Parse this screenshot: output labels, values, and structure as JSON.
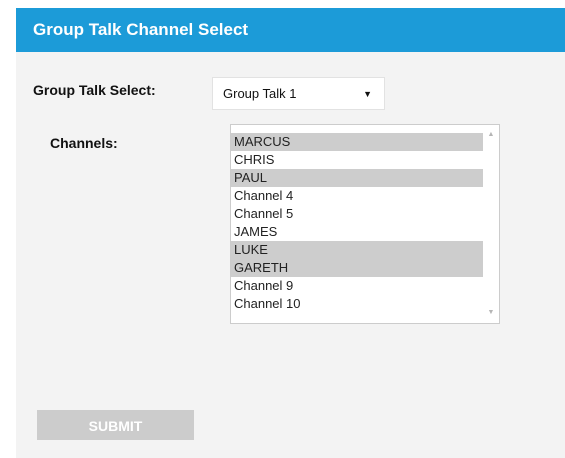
{
  "window": {
    "title": "Group Talk Channel Select"
  },
  "group_talk": {
    "label": "Group Talk Select:",
    "selected": "Group Talk 1",
    "arrow": "▼"
  },
  "channels": {
    "label": "Channels:",
    "items": [
      {
        "label": "MARCUS",
        "selected": true
      },
      {
        "label": "CHRIS",
        "selected": false
      },
      {
        "label": "PAUL",
        "selected": true
      },
      {
        "label": "Channel 4",
        "selected": false
      },
      {
        "label": "Channel 5",
        "selected": false
      },
      {
        "label": "JAMES",
        "selected": false
      },
      {
        "label": "LUKE",
        "selected": true
      },
      {
        "label": "GARETH",
        "selected": true
      },
      {
        "label": "Channel 9",
        "selected": false
      },
      {
        "label": "Channel 10",
        "selected": false
      }
    ],
    "scroll_up": "▲",
    "scroll_down": "▼"
  },
  "submit": {
    "label": "SUBMIT"
  },
  "colors": {
    "header": "#1c9bd8",
    "panel": "#f3f3f3",
    "selected_item": "#cdcdcd",
    "button": "#cccccc"
  }
}
